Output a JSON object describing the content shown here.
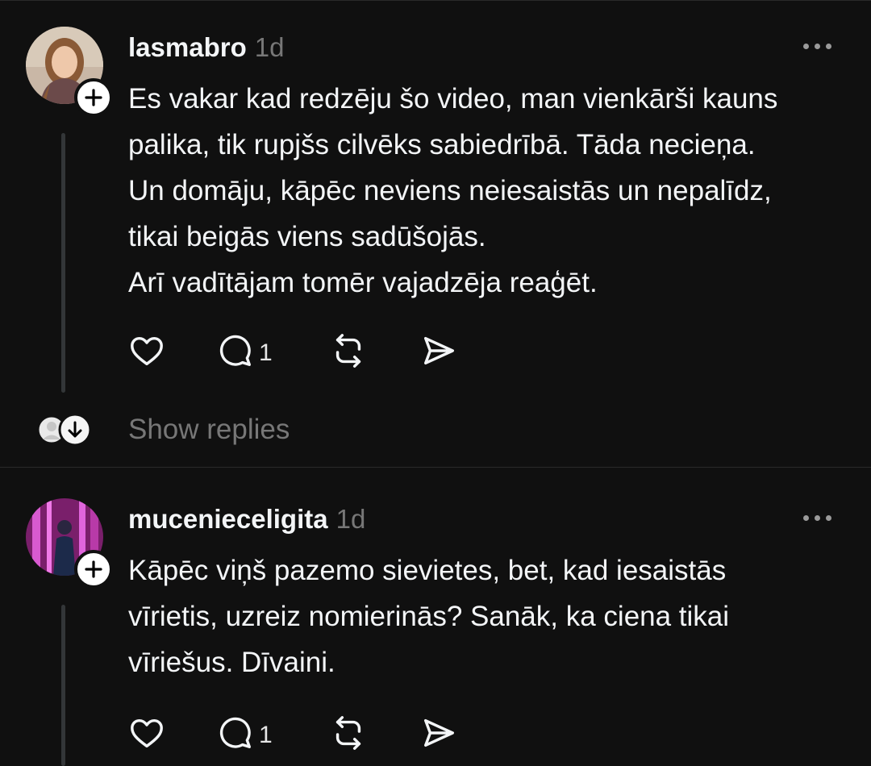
{
  "posts": [
    {
      "username": "lasmabro",
      "time": "1d",
      "text": "Es vakar kad redzēju šo video, man vienkārši kauns\npalika, tik rupjšs cilvēks sabiedrībā. Tāda necieņa.\nUn domāju, kāpēc neviens neiesaistās un nepalīdz,\ntikai beigās viens sadūšojās.\nArī vadītājam tomēr vajadzēja reaģēt.",
      "reply_count": "1",
      "show_replies_label": "Show replies"
    },
    {
      "username": "mucenieceligita",
      "time": "1d",
      "text": "Kāpēc viņš pazemo sievietes, bet, kad iesaistās\nvīrietis, uzreiz nomierinās? Sanāk, ka ciena tikai\nvīriešus. Dīvaini.",
      "reply_count": "1"
    }
  ],
  "icons": [
    "heart-icon",
    "comment-icon",
    "repost-icon",
    "share-icon",
    "more-icon",
    "follow-plus-icon",
    "arrow-down-icon"
  ],
  "colors": {
    "background": "#101010",
    "text": "#f3f5f7",
    "muted": "#777777"
  }
}
